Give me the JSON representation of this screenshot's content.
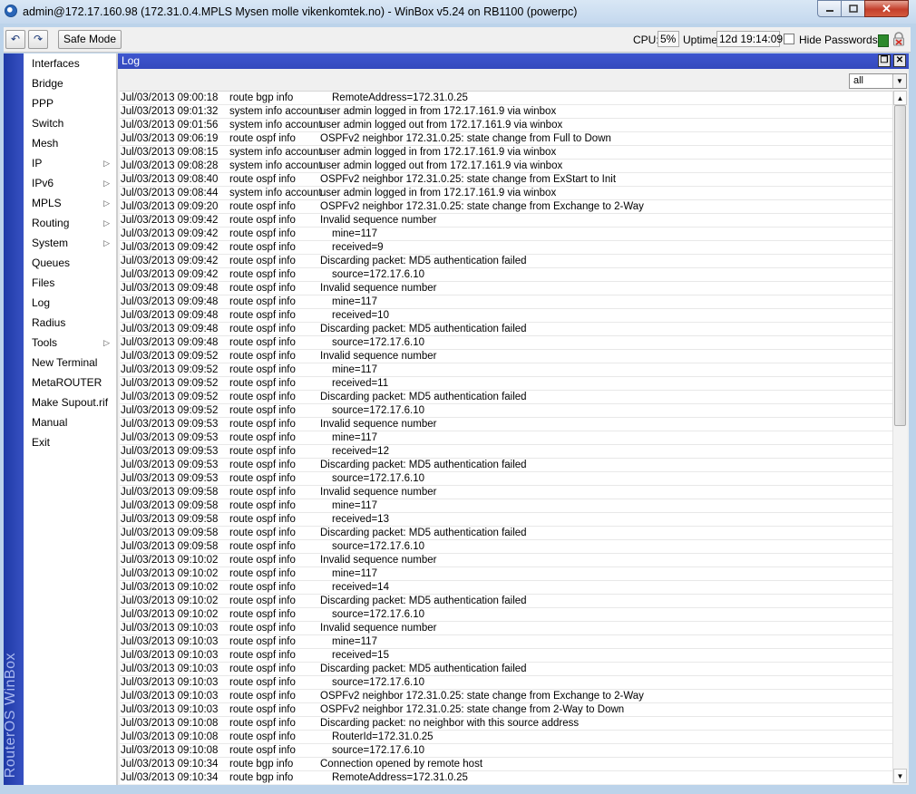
{
  "window": {
    "title": "admin@172.17.160.98 (172.31.0.4.MPLS Mysen molle vikenkomtek.no) - WinBox v5.24 on RB1100 (powerpc)",
    "minimize_icon": "minimize-icon",
    "maximize_icon": "maximize-icon",
    "close_glyph": "✕"
  },
  "toolbar": {
    "undo_glyph": "↶",
    "redo_glyph": "↷",
    "safe_mode_label": "Safe Mode",
    "cpu_label": "CPU:",
    "cpu_value": "5%",
    "uptime_label": "Uptime:",
    "uptime_value": "12d 19:14:09",
    "hide_passwords_label": "Hide Passwords",
    "status_color": "#2d8a2d"
  },
  "brand": "RouterOS WinBox",
  "sidebar": {
    "items": [
      {
        "label": "Interfaces",
        "submenu": false
      },
      {
        "label": "Bridge",
        "submenu": false
      },
      {
        "label": "PPP",
        "submenu": false
      },
      {
        "label": "Switch",
        "submenu": false
      },
      {
        "label": "Mesh",
        "submenu": false
      },
      {
        "label": "IP",
        "submenu": true
      },
      {
        "label": "IPv6",
        "submenu": true
      },
      {
        "label": "MPLS",
        "submenu": true
      },
      {
        "label": "Routing",
        "submenu": true
      },
      {
        "label": "System",
        "submenu": true
      },
      {
        "label": "Queues",
        "submenu": false
      },
      {
        "label": "Files",
        "submenu": false
      },
      {
        "label": "Log",
        "submenu": false
      },
      {
        "label": "Radius",
        "submenu": false
      },
      {
        "label": "Tools",
        "submenu": true
      },
      {
        "label": "New Terminal",
        "submenu": false
      },
      {
        "label": "MetaROUTER",
        "submenu": false
      },
      {
        "label": "Make Supout.rif",
        "submenu": false
      },
      {
        "label": "Manual",
        "submenu": false
      },
      {
        "label": "Exit",
        "submenu": false
      }
    ]
  },
  "log_window": {
    "title": "Log",
    "restore_glyph": "❐",
    "close_glyph": "✕",
    "filter_value": "all",
    "filter_arrow": "▼",
    "scroll_up": "▲",
    "scroll_down": "▼",
    "rows": [
      {
        "time": "Jul/03/2013 09:00:18",
        "topics": "route bgp info",
        "message": "RemoteAddress=172.31.0.25",
        "indent": true
      },
      {
        "time": "Jul/03/2013 09:01:32",
        "topics": "system info account",
        "message": "user admin logged in from 172.17.161.9 via winbox",
        "indent": false
      },
      {
        "time": "Jul/03/2013 09:01:56",
        "topics": "system info account",
        "message": "user admin logged out from 172.17.161.9 via winbox",
        "indent": false
      },
      {
        "time": "Jul/03/2013 09:06:19",
        "topics": "route ospf info",
        "message": "OSPFv2 neighbor 172.31.0.25: state change from Full to Down",
        "indent": false
      },
      {
        "time": "Jul/03/2013 09:08:15",
        "topics": "system info account",
        "message": "user admin logged in from 172.17.161.9 via winbox",
        "indent": false
      },
      {
        "time": "Jul/03/2013 09:08:28",
        "topics": "system info account",
        "message": "user admin logged out from 172.17.161.9 via winbox",
        "indent": false
      },
      {
        "time": "Jul/03/2013 09:08:40",
        "topics": "route ospf info",
        "message": "OSPFv2 neighbor 172.31.0.25: state change from ExStart to Init",
        "indent": false
      },
      {
        "time": "Jul/03/2013 09:08:44",
        "topics": "system info account",
        "message": "user admin logged in from 172.17.161.9 via winbox",
        "indent": false
      },
      {
        "time": "Jul/03/2013 09:09:20",
        "topics": "route ospf info",
        "message": "OSPFv2 neighbor 172.31.0.25: state change from Exchange to 2-Way",
        "indent": false
      },
      {
        "time": "Jul/03/2013 09:09:42",
        "topics": "route ospf info",
        "message": "Invalid sequence number",
        "indent": false
      },
      {
        "time": "Jul/03/2013 09:09:42",
        "topics": "route ospf info",
        "message": "mine=117",
        "indent": true
      },
      {
        "time": "Jul/03/2013 09:09:42",
        "topics": "route ospf info",
        "message": "received=9",
        "indent": true
      },
      {
        "time": "Jul/03/2013 09:09:42",
        "topics": "route ospf info",
        "message": "Discarding packet: MD5 authentication failed",
        "indent": false
      },
      {
        "time": "Jul/03/2013 09:09:42",
        "topics": "route ospf info",
        "message": "source=172.17.6.10",
        "indent": true
      },
      {
        "time": "Jul/03/2013 09:09:48",
        "topics": "route ospf info",
        "message": "Invalid sequence number",
        "indent": false
      },
      {
        "time": "Jul/03/2013 09:09:48",
        "topics": "route ospf info",
        "message": "mine=117",
        "indent": true
      },
      {
        "time": "Jul/03/2013 09:09:48",
        "topics": "route ospf info",
        "message": "received=10",
        "indent": true
      },
      {
        "time": "Jul/03/2013 09:09:48",
        "topics": "route ospf info",
        "message": "Discarding packet: MD5 authentication failed",
        "indent": false
      },
      {
        "time": "Jul/03/2013 09:09:48",
        "topics": "route ospf info",
        "message": "source=172.17.6.10",
        "indent": true
      },
      {
        "time": "Jul/03/2013 09:09:52",
        "topics": "route ospf info",
        "message": "Invalid sequence number",
        "indent": false
      },
      {
        "time": "Jul/03/2013 09:09:52",
        "topics": "route ospf info",
        "message": "mine=117",
        "indent": true
      },
      {
        "time": "Jul/03/2013 09:09:52",
        "topics": "route ospf info",
        "message": "received=11",
        "indent": true
      },
      {
        "time": "Jul/03/2013 09:09:52",
        "topics": "route ospf info",
        "message": "Discarding packet: MD5 authentication failed",
        "indent": false
      },
      {
        "time": "Jul/03/2013 09:09:52",
        "topics": "route ospf info",
        "message": "source=172.17.6.10",
        "indent": true
      },
      {
        "time": "Jul/03/2013 09:09:53",
        "topics": "route ospf info",
        "message": "Invalid sequence number",
        "indent": false
      },
      {
        "time": "Jul/03/2013 09:09:53",
        "topics": "route ospf info",
        "message": "mine=117",
        "indent": true
      },
      {
        "time": "Jul/03/2013 09:09:53",
        "topics": "route ospf info",
        "message": "received=12",
        "indent": true
      },
      {
        "time": "Jul/03/2013 09:09:53",
        "topics": "route ospf info",
        "message": "Discarding packet: MD5 authentication failed",
        "indent": false
      },
      {
        "time": "Jul/03/2013 09:09:53",
        "topics": "route ospf info",
        "message": "source=172.17.6.10",
        "indent": true
      },
      {
        "time": "Jul/03/2013 09:09:58",
        "topics": "route ospf info",
        "message": "Invalid sequence number",
        "indent": false
      },
      {
        "time": "Jul/03/2013 09:09:58",
        "topics": "route ospf info",
        "message": "mine=117",
        "indent": true
      },
      {
        "time": "Jul/03/2013 09:09:58",
        "topics": "route ospf info",
        "message": "received=13",
        "indent": true
      },
      {
        "time": "Jul/03/2013 09:09:58",
        "topics": "route ospf info",
        "message": "Discarding packet: MD5 authentication failed",
        "indent": false
      },
      {
        "time": "Jul/03/2013 09:09:58",
        "topics": "route ospf info",
        "message": "source=172.17.6.10",
        "indent": true
      },
      {
        "time": "Jul/03/2013 09:10:02",
        "topics": "route ospf info",
        "message": "Invalid sequence number",
        "indent": false
      },
      {
        "time": "Jul/03/2013 09:10:02",
        "topics": "route ospf info",
        "message": "mine=117",
        "indent": true
      },
      {
        "time": "Jul/03/2013 09:10:02",
        "topics": "route ospf info",
        "message": "received=14",
        "indent": true
      },
      {
        "time": "Jul/03/2013 09:10:02",
        "topics": "route ospf info",
        "message": "Discarding packet: MD5 authentication failed",
        "indent": false
      },
      {
        "time": "Jul/03/2013 09:10:02",
        "topics": "route ospf info",
        "message": "source=172.17.6.10",
        "indent": true
      },
      {
        "time": "Jul/03/2013 09:10:03",
        "topics": "route ospf info",
        "message": "Invalid sequence number",
        "indent": false
      },
      {
        "time": "Jul/03/2013 09:10:03",
        "topics": "route ospf info",
        "message": "mine=117",
        "indent": true
      },
      {
        "time": "Jul/03/2013 09:10:03",
        "topics": "route ospf info",
        "message": "received=15",
        "indent": true
      },
      {
        "time": "Jul/03/2013 09:10:03",
        "topics": "route ospf info",
        "message": "Discarding packet: MD5 authentication failed",
        "indent": false
      },
      {
        "time": "Jul/03/2013 09:10:03",
        "topics": "route ospf info",
        "message": "source=172.17.6.10",
        "indent": true
      },
      {
        "time": "Jul/03/2013 09:10:03",
        "topics": "route ospf info",
        "message": "OSPFv2 neighbor 172.31.0.25: state change from Exchange to 2-Way",
        "indent": false
      },
      {
        "time": "Jul/03/2013 09:10:03",
        "topics": "route ospf info",
        "message": "OSPFv2 neighbor 172.31.0.25: state change from 2-Way to Down",
        "indent": false
      },
      {
        "time": "Jul/03/2013 09:10:08",
        "topics": "route ospf info",
        "message": "Discarding packet: no neighbor with this source address",
        "indent": false
      },
      {
        "time": "Jul/03/2013 09:10:08",
        "topics": "route ospf info",
        "message": "RouterId=172.31.0.25",
        "indent": true
      },
      {
        "time": "Jul/03/2013 09:10:08",
        "topics": "route ospf info",
        "message": "source=172.17.6.10",
        "indent": true
      },
      {
        "time": "Jul/03/2013 09:10:34",
        "topics": "route bgp info",
        "message": "Connection opened by remote host",
        "indent": false
      },
      {
        "time": "Jul/03/2013 09:10:34",
        "topics": "route bgp info",
        "message": "RemoteAddress=172.31.0.25",
        "indent": true
      }
    ]
  }
}
